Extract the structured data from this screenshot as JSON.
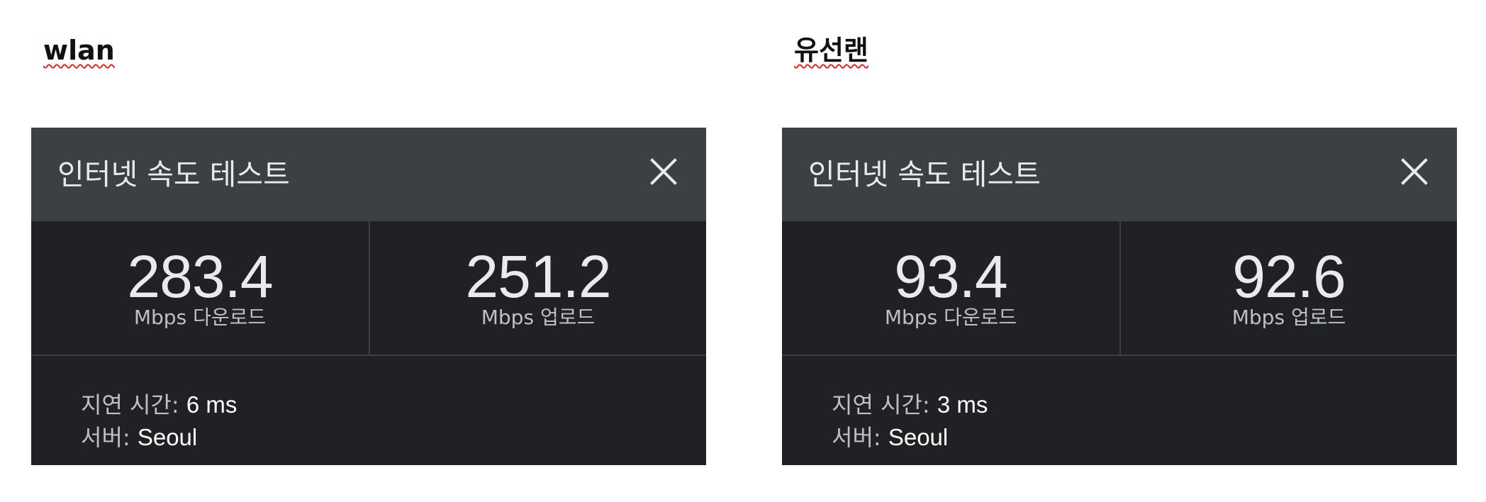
{
  "panels": [
    {
      "section_title": "wlan",
      "widget_title": "인터넷 속도 테스트",
      "download": {
        "value": "283.4",
        "label": "Mbps 다운로드"
      },
      "upload": {
        "value": "251.2",
        "label": "Mbps 업로드"
      },
      "latency": {
        "label": "지연 시간:",
        "value": "6 ms"
      },
      "server": {
        "label": "서버:",
        "value": "Seoul"
      }
    },
    {
      "section_title": "유선랜",
      "widget_title": "인터넷 속도 테스트",
      "download": {
        "value": "93.4",
        "label": "Mbps 다운로드"
      },
      "upload": {
        "value": "92.6",
        "label": "Mbps 업로드"
      },
      "latency": {
        "label": "지연 시간:",
        "value": "3 ms"
      },
      "server": {
        "label": "서버:",
        "value": "Seoul"
      }
    }
  ],
  "icons": {
    "close": "close-icon"
  },
  "colors": {
    "header_bg": "#3c4043",
    "body_bg": "#202124",
    "primary_text": "#e8eaed",
    "secondary_text": "#bdc1c6",
    "spellcheck_underline": "#d22b2b"
  }
}
